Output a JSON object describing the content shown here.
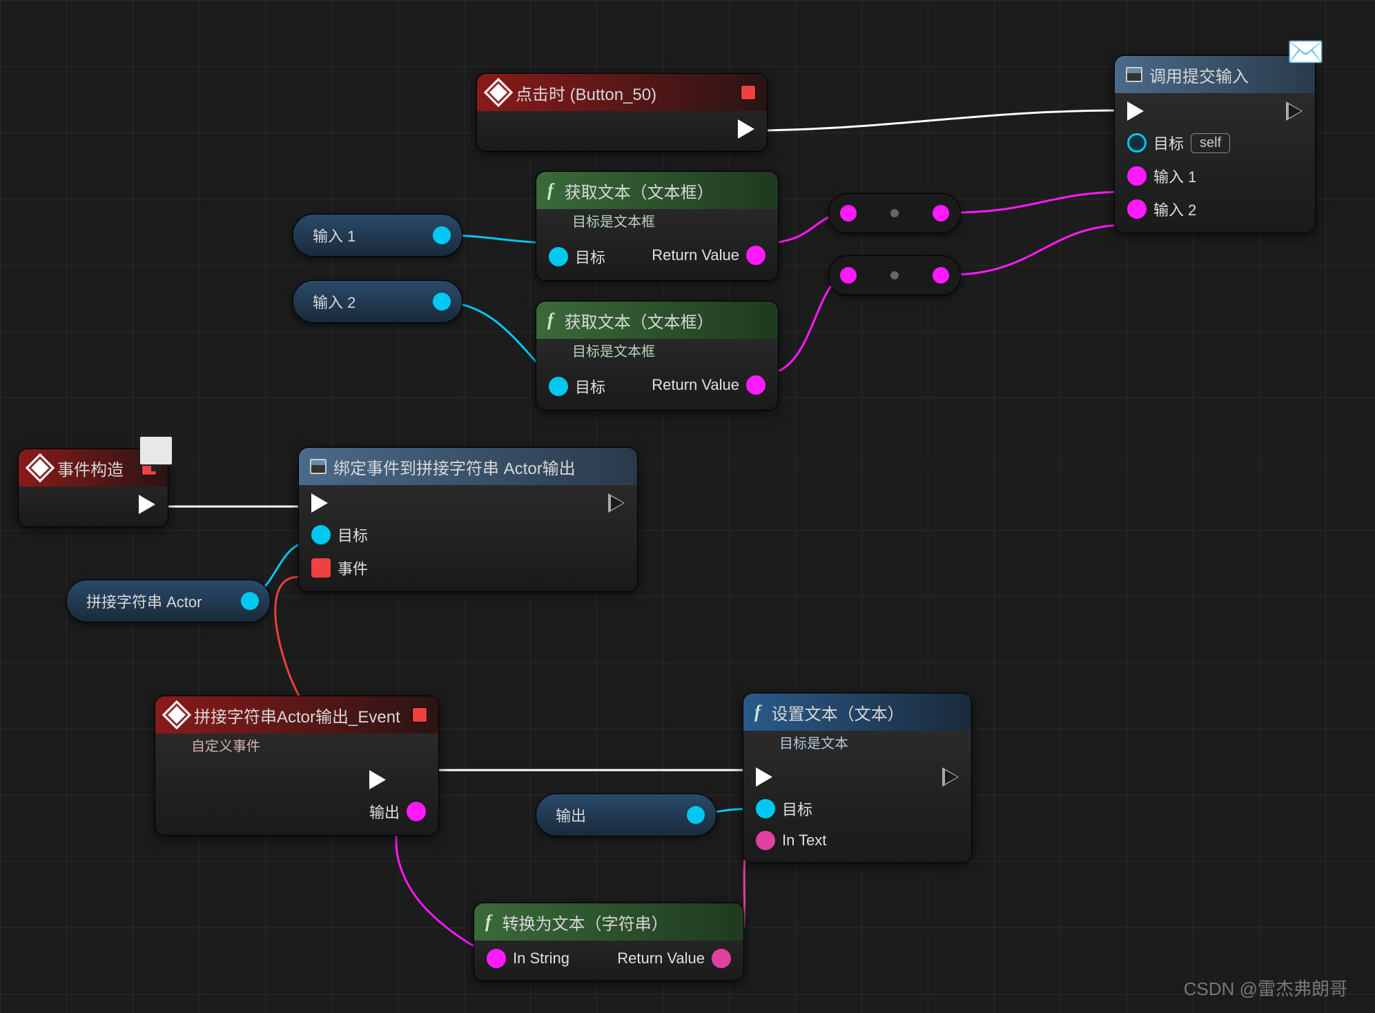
{
  "watermark": "CSDN @雷杰弗朗哥",
  "nodes": {
    "click": {
      "title": "点击时 (Button_50)"
    },
    "getText1": {
      "title": "获取文本（文本框）",
      "sub": "目标是文本框",
      "target": "目标",
      "retval": "Return Value"
    },
    "getText2": {
      "title": "获取文本（文本框）",
      "sub": "目标是文本框",
      "target": "目标",
      "retval": "Return Value"
    },
    "callSubmit": {
      "title": "调用提交输入",
      "target": "目标",
      "self": "self",
      "in1": "输入 1",
      "in2": "输入 2"
    },
    "construct": {
      "title": "事件构造"
    },
    "bind": {
      "title": "绑定事件到拼接字符串 Actor输出",
      "target": "目标",
      "event": "事件"
    },
    "customEvent": {
      "title": "拼接字符串Actor输出_Event",
      "sub": "自定义事件",
      "out": "输出"
    },
    "setText": {
      "title": "设置文本（文本）",
      "sub": "目标是文本",
      "target": "目标",
      "intext": "In Text"
    },
    "toText": {
      "title": "转换为文本（字符串）",
      "in": "In String",
      "retval": "Return Value"
    }
  },
  "pills": {
    "in1": "输入 1",
    "in2": "输入 2",
    "concat": "拼接字符串 Actor",
    "out": "输出"
  }
}
